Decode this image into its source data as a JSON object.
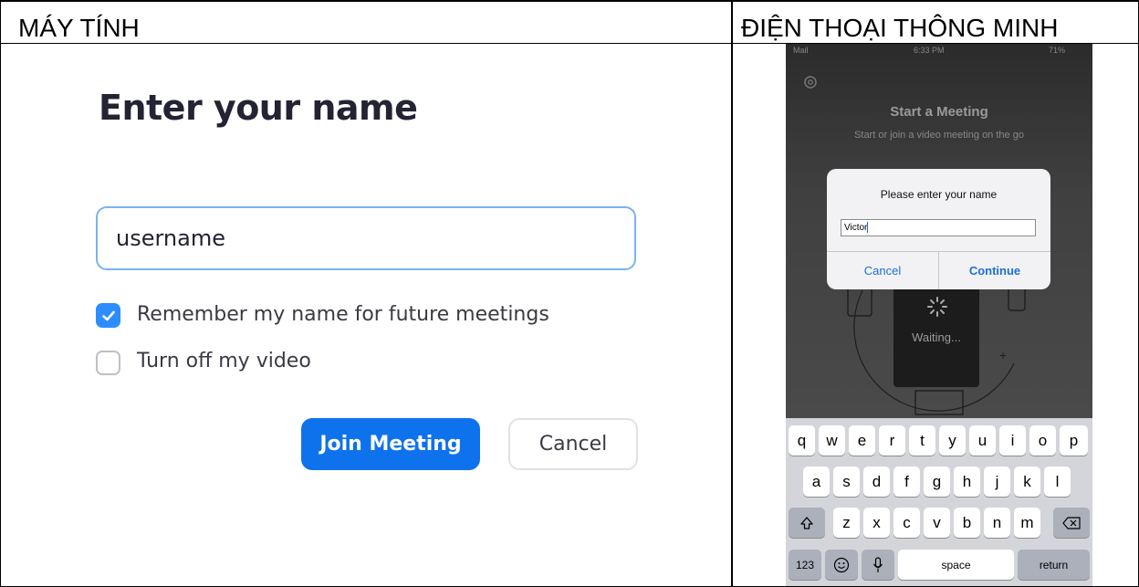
{
  "headers": {
    "desktop": "MÁY TÍNH",
    "phone": "ĐIỆN THOẠI THÔNG MINH"
  },
  "desktop": {
    "title": "Enter your name",
    "name_input": {
      "value": "username"
    },
    "remember_checkbox": {
      "label": "Remember my name for future meetings",
      "checked": true
    },
    "video_checkbox": {
      "label": "Turn off my video",
      "checked": false
    },
    "join_button": "Join Meeting",
    "cancel_button": "Cancel",
    "colors": {
      "title": "#232333",
      "primary": "#0e72ed",
      "checkbox": "#2d8cff",
      "input_border": "#7ab2f3"
    }
  },
  "phone": {
    "status": {
      "carrier": "Mail",
      "time": "6:33 PM",
      "battery": "71%"
    },
    "screen_title": "Start a Meeting",
    "screen_subtitle": "Start or join a video meeting on the go",
    "waiting_label": "Waiting...",
    "dialog": {
      "title": "Please enter your name",
      "input_value": "Victor",
      "cancel": "Cancel",
      "continue": "Continue"
    },
    "keyboard": {
      "row1": [
        "q",
        "w",
        "e",
        "r",
        "t",
        "y",
        "u",
        "i",
        "o",
        "p"
      ],
      "row2": [
        "a",
        "s",
        "d",
        "f",
        "g",
        "h",
        "j",
        "k",
        "l"
      ],
      "row3": [
        "z",
        "x",
        "c",
        "v",
        "b",
        "n",
        "m"
      ],
      "numbers_key": "123",
      "space_key": "space",
      "return_key": "return",
      "icons": [
        "shift-icon",
        "backspace-icon",
        "emoji-icon",
        "microphone-icon"
      ]
    }
  }
}
